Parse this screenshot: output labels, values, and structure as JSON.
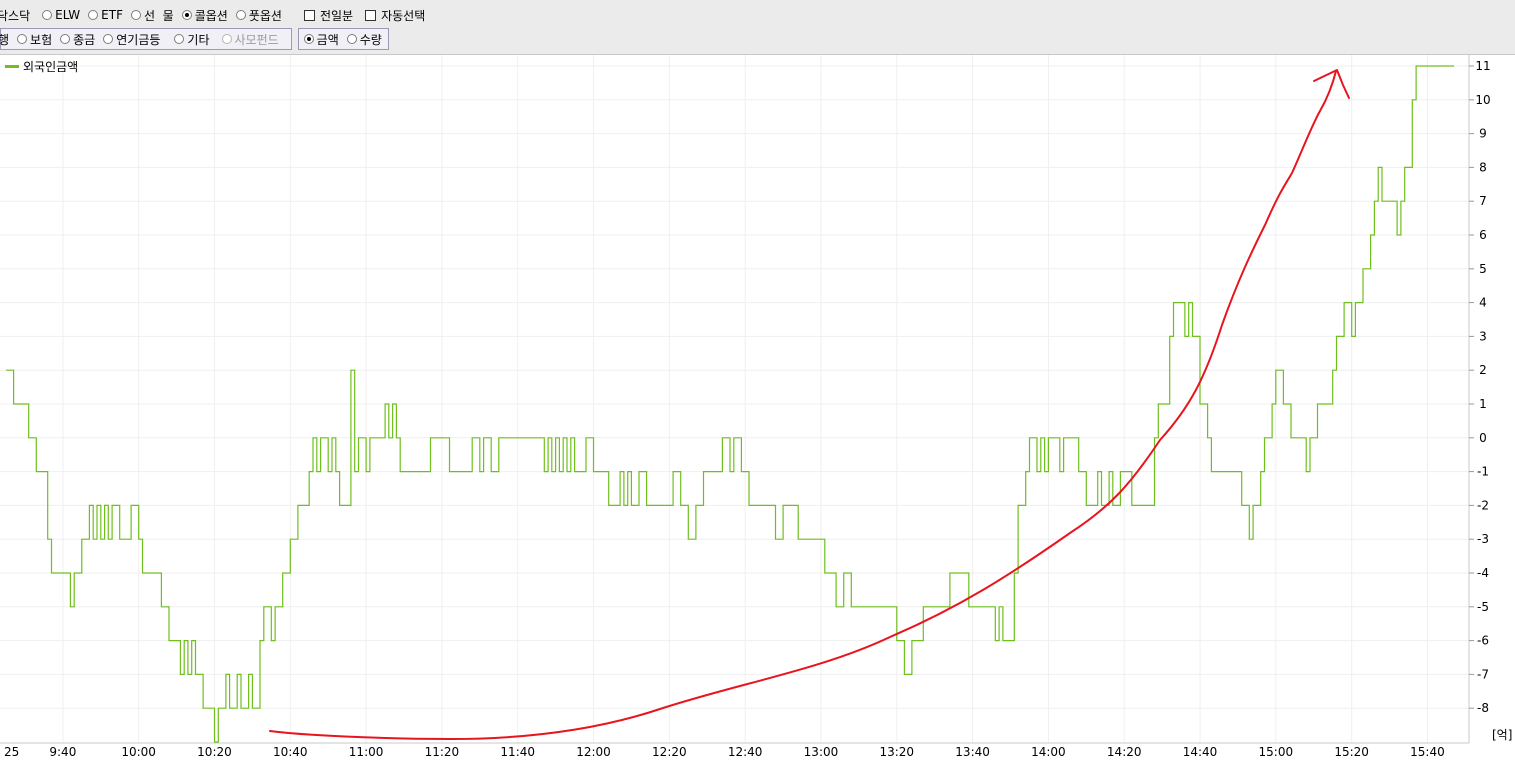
{
  "toolbar": {
    "row1": {
      "cut_label": "닥스닥",
      "options": [
        {
          "label": "ELW",
          "selected": false
        },
        {
          "label": "ETF",
          "selected": false
        },
        {
          "label": "선  물",
          "selected": false
        },
        {
          "label": "콜옵션",
          "selected": true
        },
        {
          "label": "풋옵션",
          "selected": false
        }
      ],
      "checkboxes": [
        {
          "label": "전일분",
          "checked": false
        },
        {
          "label": "자동선택",
          "checked": false
        }
      ]
    },
    "row2": {
      "cut_label": "행",
      "options": [
        {
          "label": "보험",
          "selected": false
        },
        {
          "label": "종금",
          "selected": false
        },
        {
          "label": "연기금등",
          "selected": false
        },
        {
          "label": "기타",
          "selected": false
        },
        {
          "label": "사모펀드",
          "selected": false,
          "disabled": true
        }
      ],
      "units": [
        {
          "label": "금액",
          "selected": true
        },
        {
          "label": "수량",
          "selected": false
        }
      ]
    }
  },
  "chart_data": {
    "type": "line",
    "series": [
      {
        "name": "외국인금액",
        "color": "#6fbf1f",
        "points": [
          [
            "09:25",
            2
          ],
          [
            "09:27",
            1
          ],
          [
            "09:31",
            0
          ],
          [
            "09:33",
            -1
          ],
          [
            "09:36",
            -3
          ],
          [
            "09:37",
            -4
          ],
          [
            "09:42",
            -5
          ],
          [
            "09:43",
            -4
          ],
          [
            "09:45",
            -3
          ],
          [
            "09:47",
            -2
          ],
          [
            "09:48",
            -3
          ],
          [
            "09:49",
            -2
          ],
          [
            "09:50",
            -3
          ],
          [
            "09:51",
            -2
          ],
          [
            "09:52",
            -3
          ],
          [
            "09:53",
            -2
          ],
          [
            "09:55",
            -3
          ],
          [
            "09:58",
            -2
          ],
          [
            "10:00",
            -3
          ],
          [
            "10:01",
            -4
          ],
          [
            "10:06",
            -5
          ],
          [
            "10:08",
            -6
          ],
          [
            "10:11",
            -7
          ],
          [
            "10:12",
            -6
          ],
          [
            "10:13",
            -7
          ],
          [
            "10:14",
            -6
          ],
          [
            "10:15",
            -7
          ],
          [
            "10:17",
            -8
          ],
          [
            "10:20",
            -9
          ],
          [
            "10:21",
            -8
          ],
          [
            "10:23",
            -7
          ],
          [
            "10:24",
            -8
          ],
          [
            "10:26",
            -7
          ],
          [
            "10:27",
            -8
          ],
          [
            "10:29",
            -7
          ],
          [
            "10:30",
            -8
          ],
          [
            "10:32",
            -6
          ],
          [
            "10:33",
            -5
          ],
          [
            "10:35",
            -6
          ],
          [
            "10:36",
            -5
          ],
          [
            "10:38",
            -4
          ],
          [
            "10:40",
            -3
          ],
          [
            "10:42",
            -2
          ],
          [
            "10:45",
            -1
          ],
          [
            "10:46",
            0
          ],
          [
            "10:47",
            -1
          ],
          [
            "10:48",
            0
          ],
          [
            "10:50",
            -1
          ],
          [
            "10:51",
            0
          ],
          [
            "10:52",
            -1
          ],
          [
            "10:53",
            -2
          ],
          [
            "10:56",
            2
          ],
          [
            "10:57",
            -1
          ],
          [
            "10:58",
            0
          ],
          [
            "11:00",
            -1
          ],
          [
            "11:01",
            0
          ],
          [
            "11:03",
            0
          ],
          [
            "11:05",
            1
          ],
          [
            "11:06",
            0
          ],
          [
            "11:07",
            1
          ],
          [
            "11:08",
            0
          ],
          [
            "11:09",
            -1
          ],
          [
            "11:15",
            -1
          ],
          [
            "11:17",
            0
          ],
          [
            "11:20",
            0
          ],
          [
            "11:22",
            -1
          ],
          [
            "11:27",
            -1
          ],
          [
            "11:28",
            0
          ],
          [
            "11:30",
            -1
          ],
          [
            "11:31",
            0
          ],
          [
            "11:33",
            -1
          ],
          [
            "11:35",
            0
          ],
          [
            "11:45",
            0
          ],
          [
            "11:47",
            -1
          ],
          [
            "11:48",
            0
          ],
          [
            "11:49",
            -1
          ],
          [
            "11:50",
            0
          ],
          [
            "11:51",
            -1
          ],
          [
            "11:52",
            0
          ],
          [
            "11:53",
            -1
          ],
          [
            "11:54",
            0
          ],
          [
            "11:55",
            -1
          ],
          [
            "11:57",
            -1
          ],
          [
            "11:58",
            0
          ],
          [
            "12:00",
            -1
          ],
          [
            "12:04",
            -2
          ],
          [
            "12:07",
            -1
          ],
          [
            "12:08",
            -2
          ],
          [
            "12:09",
            -1
          ],
          [
            "12:10",
            -2
          ],
          [
            "12:12",
            -1
          ],
          [
            "12:14",
            -2
          ],
          [
            "12:19",
            -2
          ],
          [
            "12:21",
            -1
          ],
          [
            "12:23",
            -2
          ],
          [
            "12:25",
            -3
          ],
          [
            "12:27",
            -2
          ],
          [
            "12:29",
            -1
          ],
          [
            "12:33",
            -1
          ],
          [
            "12:34",
            0
          ],
          [
            "12:36",
            -1
          ],
          [
            "12:37",
            0
          ],
          [
            "12:39",
            -1
          ],
          [
            "12:41",
            -2
          ],
          [
            "12:46",
            -2
          ],
          [
            "12:48",
            -3
          ],
          [
            "12:50",
            -2
          ],
          [
            "12:54",
            -3
          ],
          [
            "12:59",
            -3
          ],
          [
            "13:01",
            -4
          ],
          [
            "13:04",
            -5
          ],
          [
            "13:06",
            -4
          ],
          [
            "13:08",
            -5
          ],
          [
            "13:20",
            -6
          ],
          [
            "13:22",
            -7
          ],
          [
            "13:24",
            -6
          ],
          [
            "13:27",
            -5
          ],
          [
            "13:32",
            -5
          ],
          [
            "13:34",
            -4
          ],
          [
            "13:39",
            -5
          ],
          [
            "13:45",
            -5
          ],
          [
            "13:46",
            -6
          ],
          [
            "13:47",
            -5
          ],
          [
            "13:48",
            -6
          ],
          [
            "13:51",
            -4
          ],
          [
            "13:52",
            -2
          ],
          [
            "13:54",
            -1
          ],
          [
            "13:55",
            0
          ],
          [
            "13:57",
            -1
          ],
          [
            "13:58",
            0
          ],
          [
            "13:59",
            -1
          ],
          [
            "14:00",
            0
          ],
          [
            "14:03",
            -1
          ],
          [
            "14:04",
            0
          ],
          [
            "14:07",
            0
          ],
          [
            "14:08",
            -1
          ],
          [
            "14:10",
            -2
          ],
          [
            "14:13",
            -1
          ],
          [
            "14:14",
            -2
          ],
          [
            "14:16",
            -1
          ],
          [
            "14:17",
            -2
          ],
          [
            "14:19",
            -1
          ],
          [
            "14:22",
            -2
          ],
          [
            "14:27",
            -2
          ],
          [
            "14:28",
            0
          ],
          [
            "14:29",
            1
          ],
          [
            "14:32",
            3
          ],
          [
            "14:33",
            4
          ],
          [
            "14:36",
            3
          ],
          [
            "14:37",
            4
          ],
          [
            "14:38",
            3
          ],
          [
            "14:40",
            1
          ],
          [
            "14:42",
            0
          ],
          [
            "14:43",
            -1
          ],
          [
            "14:50",
            -1
          ],
          [
            "14:51",
            -2
          ],
          [
            "14:53",
            -3
          ],
          [
            "14:54",
            -2
          ],
          [
            "14:56",
            -1
          ],
          [
            "14:57",
            0
          ],
          [
            "14:59",
            1
          ],
          [
            "15:00",
            2
          ],
          [
            "15:02",
            1
          ],
          [
            "15:04",
            0
          ],
          [
            "15:08",
            -1
          ],
          [
            "15:09",
            0
          ],
          [
            "15:11",
            1
          ],
          [
            "15:13",
            1
          ],
          [
            "15:15",
            2
          ],
          [
            "15:16",
            3
          ],
          [
            "15:18",
            4
          ],
          [
            "15:20",
            3
          ],
          [
            "15:21",
            4
          ],
          [
            "15:23",
            5
          ],
          [
            "15:25",
            6
          ],
          [
            "15:26",
            7
          ],
          [
            "15:27",
            8
          ],
          [
            "15:28",
            7
          ],
          [
            "15:32",
            6
          ],
          [
            "15:33",
            7
          ],
          [
            "15:34",
            8
          ],
          [
            "15:36",
            10
          ],
          [
            "15:37",
            11
          ],
          [
            "15:47",
            11
          ]
        ]
      }
    ],
    "annotation": {
      "type": "arrow",
      "color": "#e8141e",
      "description": "hand-drawn upward red arrow"
    },
    "x_range": [
      "09:25",
      "15:47"
    ],
    "x_tick_labels": [
      "25",
      "9:40",
      "10:00",
      "10:20",
      "10:40",
      "11:00",
      "11:20",
      "11:40",
      "12:00",
      "12:20",
      "12:40",
      "13:00",
      "13:20",
      "13:40",
      "14:00",
      "14:20",
      "14:40",
      "15:00",
      "15:20",
      "15:40"
    ],
    "ylim": [
      -9,
      11
    ],
    "y_tick_labels": [
      "11",
      "10",
      "9",
      "8",
      "7",
      "6",
      "5",
      "4",
      "3",
      "2",
      "1",
      "0",
      "-1",
      "-2",
      "-3",
      "-4",
      "-5",
      "-6",
      "-7",
      "-8"
    ],
    "y_unit": "[억]",
    "legend": "top-left",
    "grid": true
  }
}
